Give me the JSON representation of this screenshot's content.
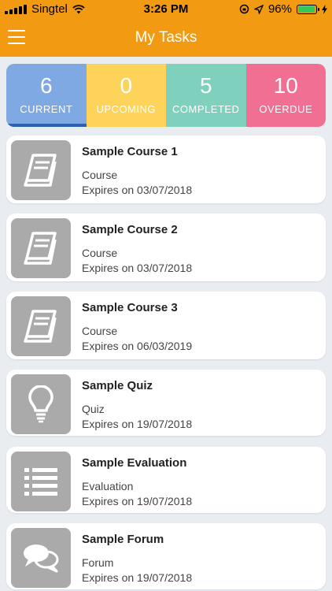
{
  "status_bar": {
    "carrier": "Singtel",
    "time": "3:26 PM",
    "battery_text": "96%",
    "battery_level": 0.96
  },
  "app_bar": {
    "title": "My Tasks",
    "menu_icon": "hamburger-menu-icon"
  },
  "stats": [
    {
      "count": "6",
      "label": "CURRENT",
      "color": "#7fa9e3"
    },
    {
      "count": "0",
      "label": "UPCOMING",
      "color": "#fdd35a"
    },
    {
      "count": "5",
      "label": "COMPLETED",
      "color": "#7fd1bd"
    },
    {
      "count": "10",
      "label": "OVERDUE",
      "color": "#f26f94"
    }
  ],
  "tasks": [
    {
      "title": "Sample Course 1",
      "type": "Course",
      "expires": "Expires on 03/07/2018",
      "icon": "book-icon"
    },
    {
      "title": "Sample Course 2",
      "type": "Course",
      "expires": "Expires on 03/07/2018",
      "icon": "book-icon"
    },
    {
      "title": "Sample Course 3",
      "type": "Course",
      "expires": "Expires on 06/03/2019",
      "icon": "book-icon"
    },
    {
      "title": "Sample Quiz",
      "type": "Quiz",
      "expires": "Expires on 19/07/2018",
      "icon": "lightbulb-icon"
    },
    {
      "title": "Sample Evaluation",
      "type": "Evaluation",
      "expires": "Expires on 19/07/2018",
      "icon": "list-icon"
    },
    {
      "title": "Sample Forum",
      "type": "Forum",
      "expires": "Expires on 19/07/2018",
      "icon": "chat-bubbles-icon"
    }
  ]
}
